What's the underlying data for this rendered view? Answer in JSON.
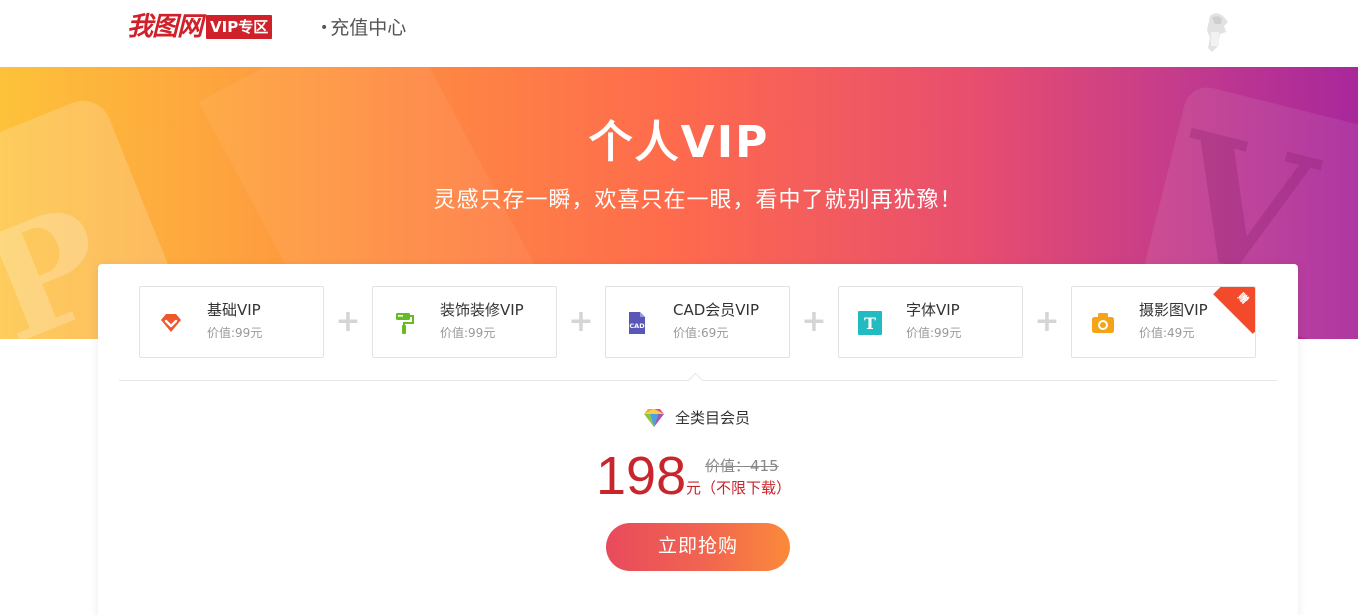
{
  "header": {
    "logo_text": "我图网",
    "logo_badge": "VIP专区",
    "nav_dot": "•",
    "nav_title": "充值中心"
  },
  "banner": {
    "title": "个人VIP",
    "subtitle": "灵感只存一瞬，欢喜只在一眼，看中了就别再犹豫！"
  },
  "items": [
    {
      "name": "基础VIP",
      "value": "价值:99元",
      "icon": "diamond-icon",
      "color": "#f0562e"
    },
    {
      "name": "装饰装修VIP",
      "value": "价值:99元",
      "icon": "paint-roller-icon",
      "color": "#66bb22"
    },
    {
      "name": "CAD会员VIP",
      "value": "价值:69元",
      "icon": "cad-file-icon",
      "color": "#5a56b8"
    },
    {
      "name": "字体VIP",
      "value": "价值:99元",
      "icon": "font-icon",
      "color": "#22bbc2"
    },
    {
      "name": "摄影图VIP",
      "value": "价值:49元",
      "icon": "camera-icon",
      "color": "#f5a417",
      "ribbon": "赠"
    }
  ],
  "plus_sign": "+",
  "package": {
    "label": "全类目会员",
    "price": "198",
    "original": "价值：415",
    "unit": "元（不限下载）",
    "buy_label": "立即抢购"
  },
  "colors": {
    "brand_red": "#d0202a",
    "price_red": "#c8252c"
  }
}
